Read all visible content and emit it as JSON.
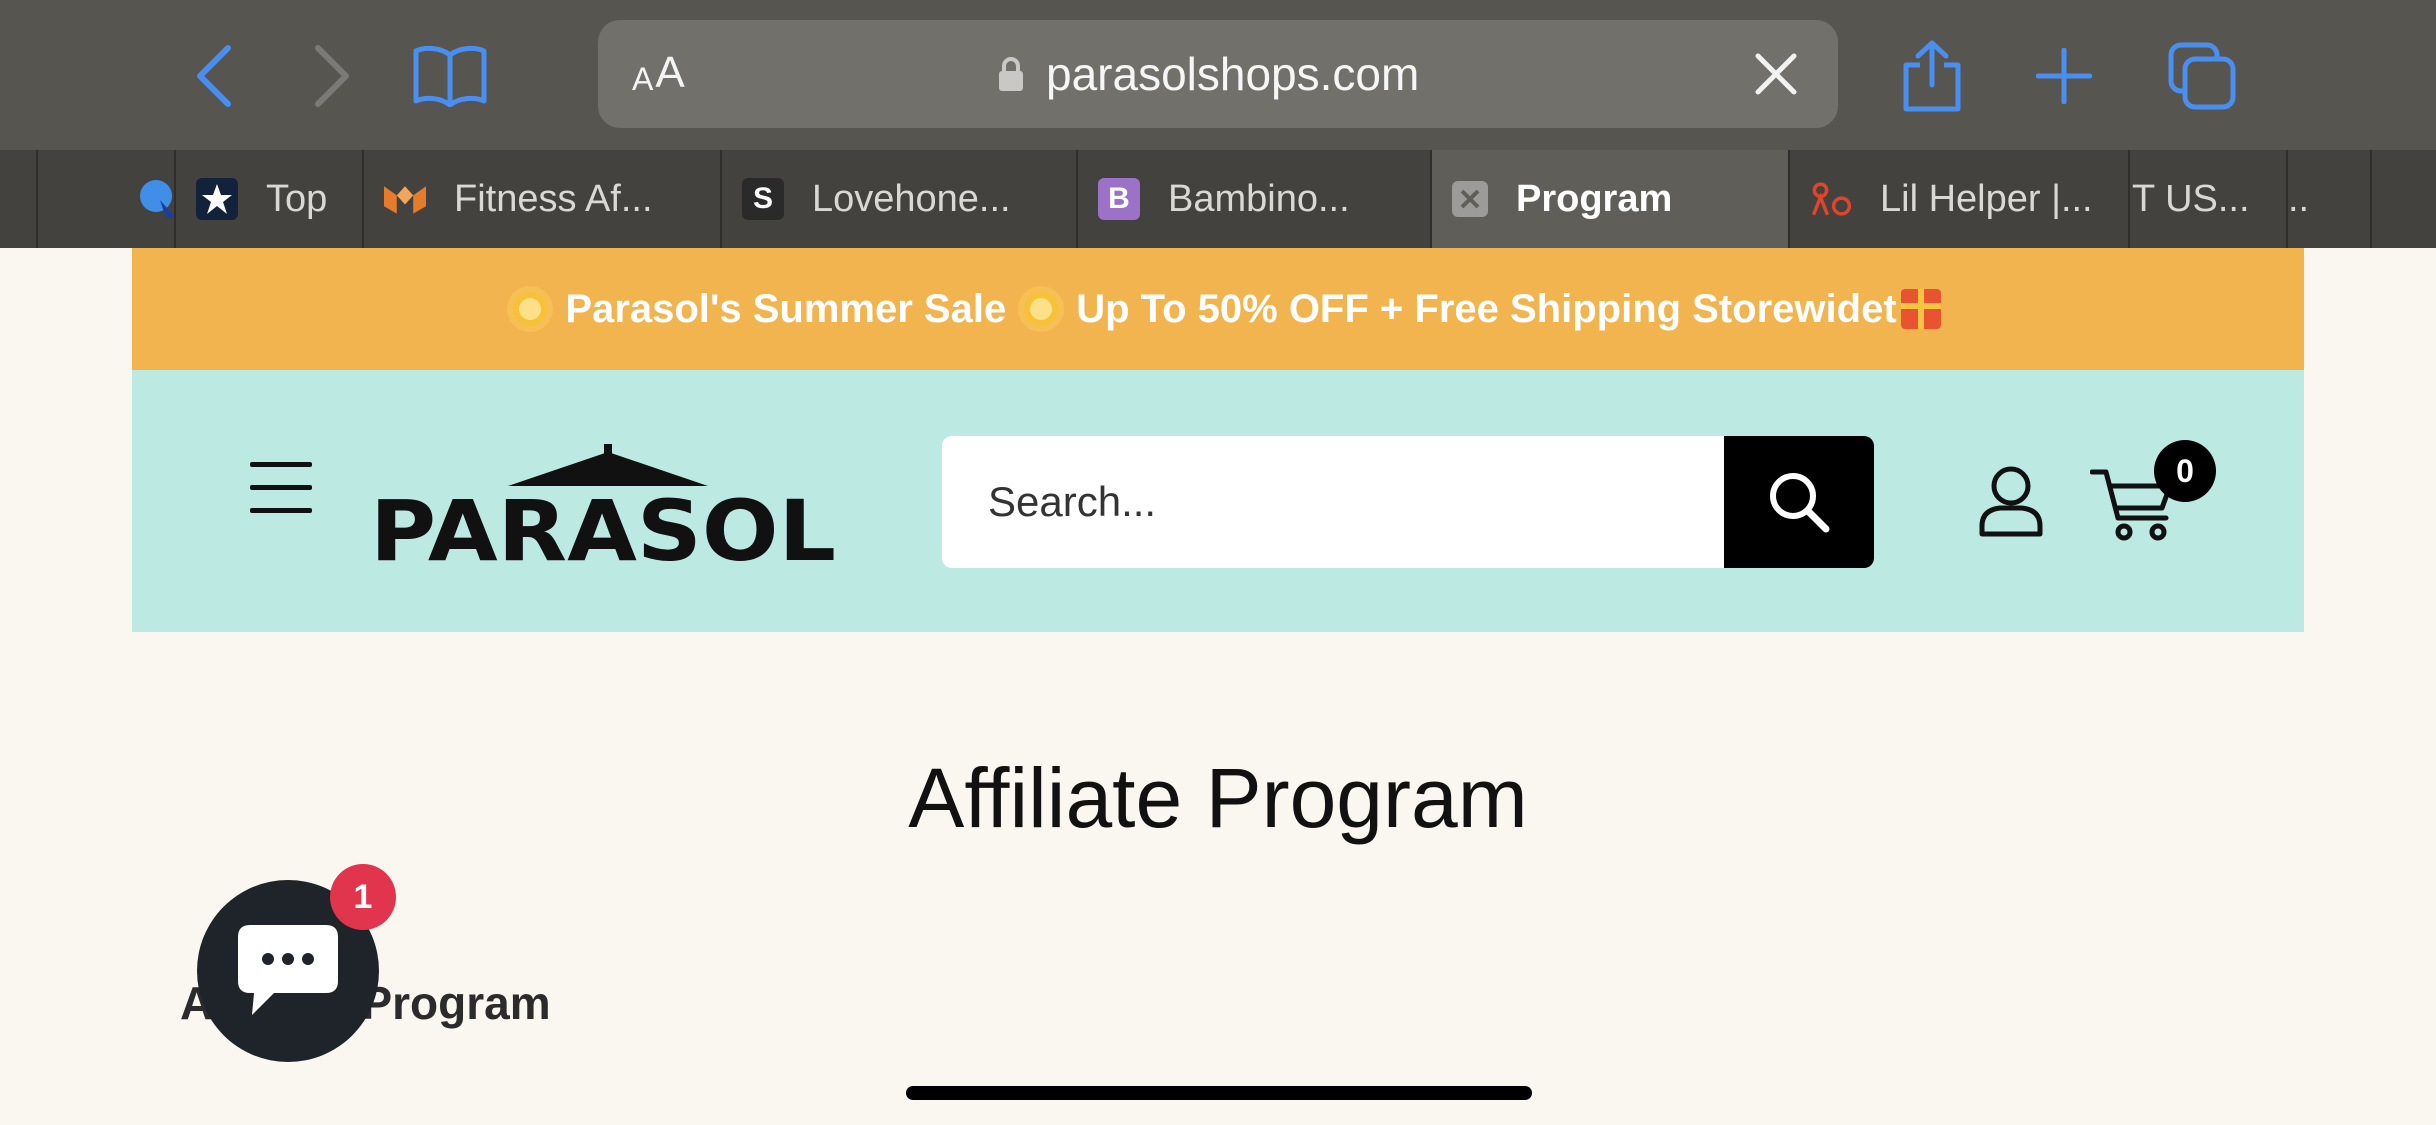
{
  "browser": {
    "url": "parasolshops.com",
    "reader_small_a": "A",
    "reader_large_a": "A",
    "accent_color": "#4a8ef0"
  },
  "tabs": [
    {
      "label": "",
      "icon": "blue-bird-favicon"
    },
    {
      "label": "Top",
      "icon": "star-logo-favicon"
    },
    {
      "label": "Fitness Af...",
      "icon": "orange-m-favicon"
    },
    {
      "label": "Lovehone...",
      "icon": "s-favicon",
      "icon_text": "S"
    },
    {
      "label": "Bambino...",
      "icon": "b-favicon",
      "icon_text": "B"
    },
    {
      "label": "Program",
      "icon": "close-icon",
      "active": true
    },
    {
      "label": "Lil Helper |...",
      "icon": "red-figure-favicon"
    },
    {
      "label": "T US...",
      "icon": ""
    },
    {
      "label": "..",
      "icon": ""
    }
  ],
  "announcement": {
    "text_part1": "Parasol's Summer Sale",
    "text_part2": "Up To 50% OFF + Free Shipping Storewidet",
    "background": "#f2b44f"
  },
  "header": {
    "logo_text": "PARASOL",
    "search_placeholder": "Search...",
    "cart_count": "0",
    "background": "#bde9e3"
  },
  "page": {
    "title": "Affiliate Program",
    "section_heading": "Affiliate Program",
    "chat_badge": "1"
  }
}
